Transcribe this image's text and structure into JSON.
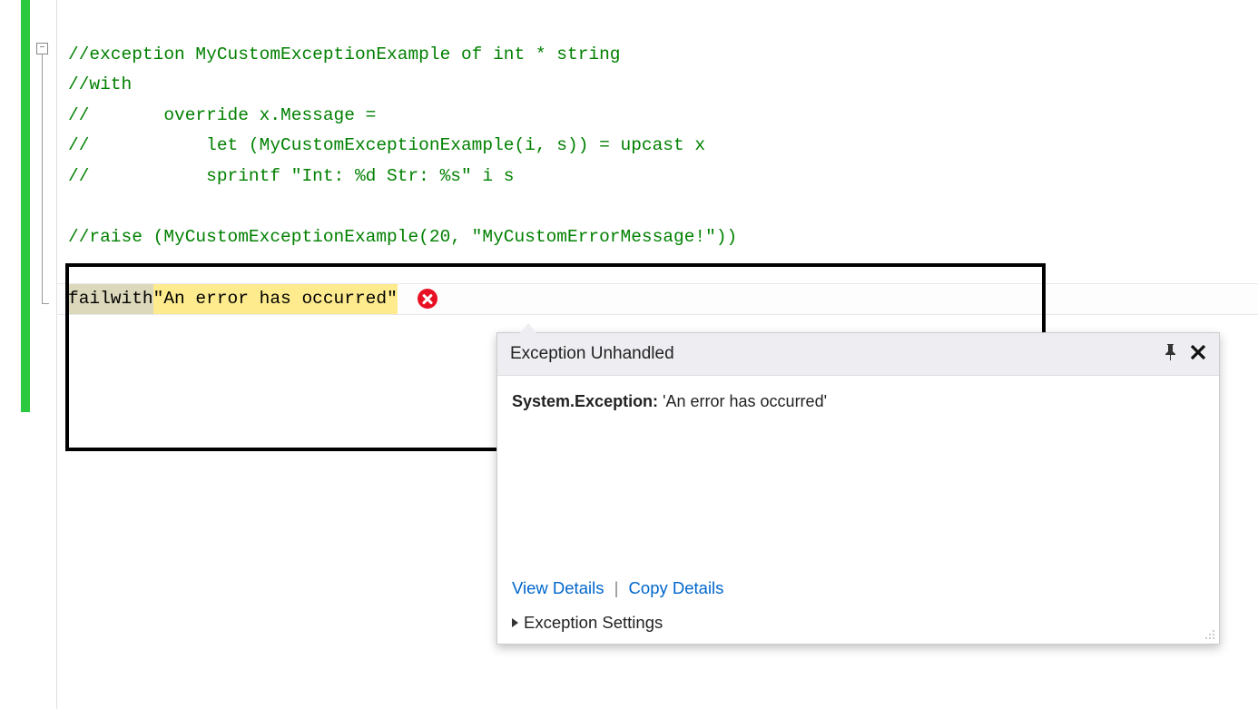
{
  "code": {
    "line1": "//exception MyCustomExceptionExample of int * string",
    "line2": "//with",
    "line3": "//       override x.Message =",
    "line4": "//           let (MyCustomExceptionExample(i, s)) = upcast x",
    "line5": "//           sprintf \"Int: %d Str: %s\" i s",
    "line6": "//raise (MyCustomExceptionExample(20, \"MyCustomErrorMessage!\"))",
    "keyword": "failwith",
    "string_literal": " \"An error has occurred\""
  },
  "popup": {
    "title": "Exception Unhandled",
    "exception_type": "System.Exception:",
    "exception_message": " 'An error has occurred'",
    "view_details": "View Details",
    "copy_details": "Copy Details",
    "settings_label": "Exception Settings"
  },
  "icons": {
    "collapse": "⊟",
    "pin": "📌",
    "close": "✕"
  }
}
